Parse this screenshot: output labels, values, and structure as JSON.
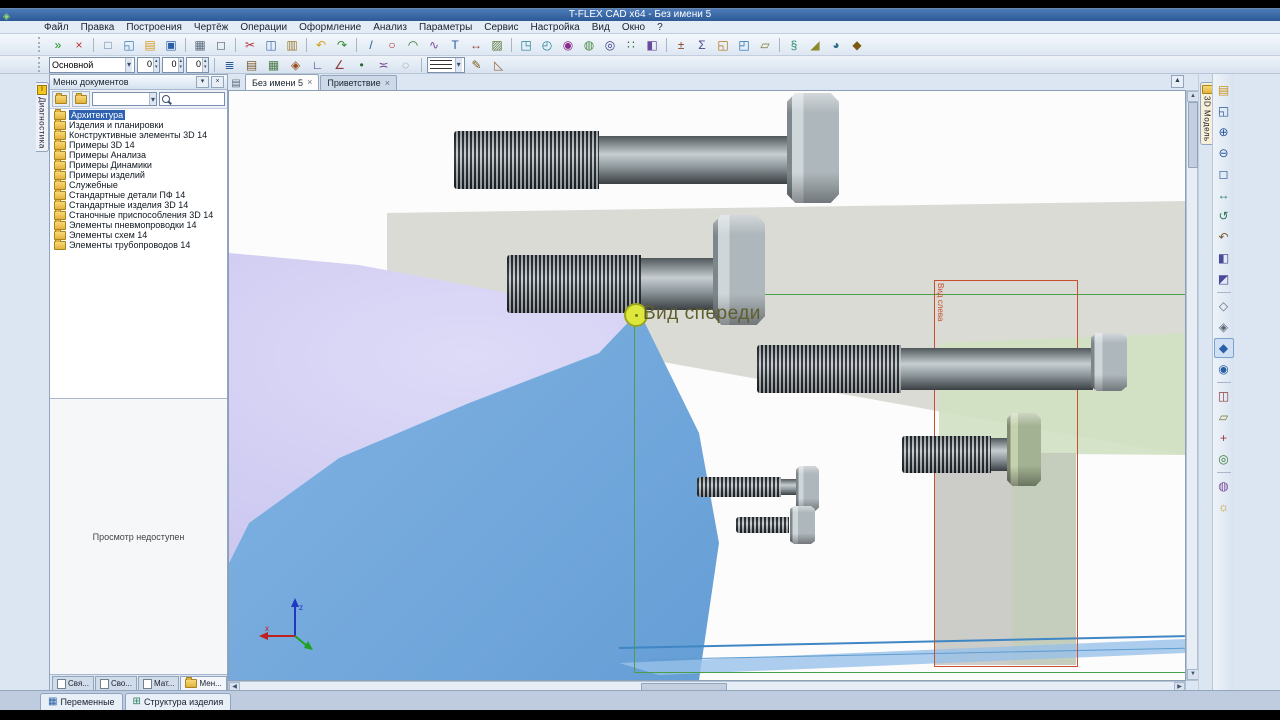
{
  "window": {
    "title": "T-FLEX CAD x64 - Без имени 5"
  },
  "menubar": {
    "items": [
      "Файл",
      "Правка",
      "Построения",
      "Чертёж",
      "Операции",
      "Оформление",
      "Анализ",
      "Параметры",
      "Сервис",
      "Настройка",
      "Вид",
      "Окно",
      "?"
    ]
  },
  "toolbar_main": {
    "icons": [
      [
        "finish-input-icon",
        "»",
        "#1f8a1f"
      ],
      [
        "cancel-input-icon",
        "×",
        "#c03030"
      ],
      [
        "sep"
      ],
      [
        "new-document-icon",
        "□",
        "#5a7a9a"
      ],
      [
        "new-3d-document-icon",
        "◱",
        "#3a7ab0"
      ],
      [
        "open-document-icon",
        "▤",
        "#d69a20"
      ],
      [
        "save-icon",
        "▣",
        "#2a5fa5"
      ],
      [
        "sep"
      ],
      [
        "print-icon",
        "▦",
        "#5a6a7a"
      ],
      [
        "print-preview-icon",
        "◻",
        "#5a6a7a"
      ],
      [
        "sep"
      ],
      [
        "cut-icon",
        "✂",
        "#b03030"
      ],
      [
        "copy-icon",
        "◫",
        "#3a6aaa"
      ],
      [
        "paste-icon",
        "▥",
        "#a07a30"
      ],
      [
        "sep"
      ],
      [
        "undo-icon",
        "↶",
        "#d4a017"
      ],
      [
        "redo-icon",
        "↷",
        "#2e8b2e"
      ],
      [
        "sep"
      ],
      [
        "line-icon",
        "/",
        "#20609f"
      ],
      [
        "circle-icon",
        "○",
        "#b03030"
      ],
      [
        "arc-icon",
        "◠",
        "#2a7a2a"
      ],
      [
        "spline-icon",
        "∿",
        "#7a4aa0"
      ],
      [
        "text-icon",
        "T",
        "#2a5a9a"
      ],
      [
        "dimension-icon",
        "↔",
        "#9a3a3a"
      ],
      [
        "hatch-icon",
        "▨",
        "#5a7a3a"
      ],
      [
        "sep"
      ],
      [
        "extrusion-icon",
        "◳",
        "#1f7f8f"
      ],
      [
        "rotation-icon",
        "◴",
        "#1f7f8f"
      ],
      [
        "boolean-icon",
        "◉",
        "#8a2a8a"
      ],
      [
        "blend-icon",
        "◍",
        "#4a8a4a"
      ],
      [
        "hole-icon",
        "◎",
        "#3a3a8a"
      ],
      [
        "array-icon",
        "∷",
        "#3a6a3a"
      ],
      [
        "mirror-icon",
        "◧",
        "#6a4a9a"
      ],
      [
        "sep"
      ],
      [
        "measure-icon",
        "±",
        "#8a4a2a"
      ],
      [
        "mass-properties-icon",
        "Σ",
        "#4a4a8a"
      ],
      [
        "assembly-icon",
        "◱",
        "#b07018"
      ],
      [
        "fragment-icon",
        "◰",
        "#1a6ab0"
      ],
      [
        "workplane-icon",
        "▱",
        "#7a7a2a"
      ],
      [
        "sep"
      ],
      [
        "helix-icon",
        "§",
        "#2a8a6a"
      ],
      [
        "chamfer-icon",
        "◢",
        "#8a8a2a"
      ],
      [
        "fillet-icon",
        "◕",
        "#2a6a8a"
      ],
      [
        "visual-settings-icon",
        "◆",
        "#7a5a10"
      ]
    ]
  },
  "toolbar_params": {
    "layer_value": "Основной",
    "spinners": [
      "0",
      "0",
      "0"
    ],
    "icons": [
      [
        "layers-icon",
        "≣",
        "#2a5a9a"
      ],
      [
        "layer-settings-icon",
        "▤",
        "#7a5a2a"
      ],
      [
        "grid-icon",
        "▦",
        "#4a7a4a"
      ],
      [
        "snap-icon",
        "◈",
        "#9a4a1a"
      ],
      [
        "ortho-icon",
        "∟",
        "#3a3a8a"
      ],
      [
        "angle-icon",
        "∠",
        "#8a3a3a"
      ],
      [
        "nodes-icon",
        "•",
        "#2a6a2a"
      ],
      [
        "relations-icon",
        "≍",
        "#6a3a8a"
      ],
      [
        "construction-lines-icon",
        "◌",
        "#707a88"
      ]
    ],
    "icons_after": [
      [
        "pen-style-icon",
        "✎",
        "#7a5a1a"
      ],
      [
        "eraser-icon",
        "◺",
        "#9a6a3a"
      ]
    ]
  },
  "left_tabstrip": {
    "label": "Диагностика"
  },
  "docs_panel": {
    "title": "Меню документов",
    "pin_glyph": "▾",
    "close_glyph": "×",
    "tree": [
      "Архитектура",
      "Изделия и планировки",
      "Конструктивные элементы 3D 14",
      "Примеры 3D 14",
      "Примеры Анализа",
      "Примеры Динамики",
      "Примеры изделий",
      "Служебные",
      "Стандартные детали ПФ 14",
      "Стандартные изделия 3D 14",
      "Станочные приспособления 3D 14",
      "Элементы пневмопроводки 14",
      "Элементы схем 14",
      "Элементы трубопроводов 14"
    ],
    "selected_index": 0,
    "preview_text": "Просмотр недоступен",
    "bottom_tabs": [
      "Свя...",
      "Сво...",
      "Мат...",
      "Мен..."
    ],
    "bottom_active_index": 3
  },
  "doc_area": {
    "tabs": [
      {
        "label": "Без имени 5",
        "close": "×",
        "active": true
      },
      {
        "label": "Приветствие",
        "close": "×",
        "active": false
      }
    ]
  },
  "viewport": {
    "front_view_label": "Вид спереди",
    "side_view_label": "Вид слева",
    "axes": {
      "x": "x",
      "z": "z"
    }
  },
  "right_tabstrip": {
    "label": "3D Модель"
  },
  "right_toolbar": {
    "icons": [
      [
        "open-3d-model-icon",
        "▤",
        "#c8941a"
      ],
      [
        "zoom-window-icon",
        "◱",
        "#2a5a9a"
      ],
      [
        "zoom-in-icon",
        "⊕",
        "#2a5a9a"
      ],
      [
        "zoom-out-icon",
        "⊖",
        "#2a5a9a"
      ],
      [
        "zoom-all-icon",
        "◻",
        "#2a5a9a"
      ],
      [
        "pan-view-icon",
        "↔",
        "#2a7a5a"
      ],
      [
        "rotate-view-icon",
        "↺",
        "#2a7a5a"
      ],
      [
        "previous-view-icon",
        "↶",
        "#7a5a2a"
      ],
      [
        "front-view-icon",
        "◧",
        "#4a4a9a"
      ],
      [
        "isometry-view-icon",
        "◩",
        "#4a4a9a"
      ],
      [
        "sep"
      ],
      [
        "wireframe-mode-icon",
        "◇",
        "#5a6a7a"
      ],
      [
        "hidden-lines-mode-icon",
        "◈",
        "#5a6a7a"
      ],
      [
        "shaded-mode-icon",
        "◆",
        "#2a5fa5",
        true
      ],
      [
        "shaded-edges-mode-icon",
        "◉",
        "#2a5fa5"
      ],
      [
        "sep"
      ],
      [
        "section-view-icon",
        "◫",
        "#8a3a3a"
      ],
      [
        "workplanes-toggle-icon",
        "▱",
        "#7a7a2a"
      ],
      [
        "axes-toggle-icon",
        "+",
        "#9a3a3a"
      ],
      [
        "lcs-icon",
        "◎",
        "#3a7a3a"
      ],
      [
        "sep"
      ],
      [
        "materials-icon",
        "◍",
        "#7a4a9a"
      ],
      [
        "lighting-icon",
        "☼",
        "#c8941a"
      ]
    ]
  },
  "bottom_bar": {
    "tabs": [
      {
        "label": "Переменные",
        "icon": "▦",
        "color": "#2a5fa5"
      },
      {
        "label": "Структура изделия",
        "icon": "⊞",
        "color": "#2a7a5a"
      }
    ]
  }
}
